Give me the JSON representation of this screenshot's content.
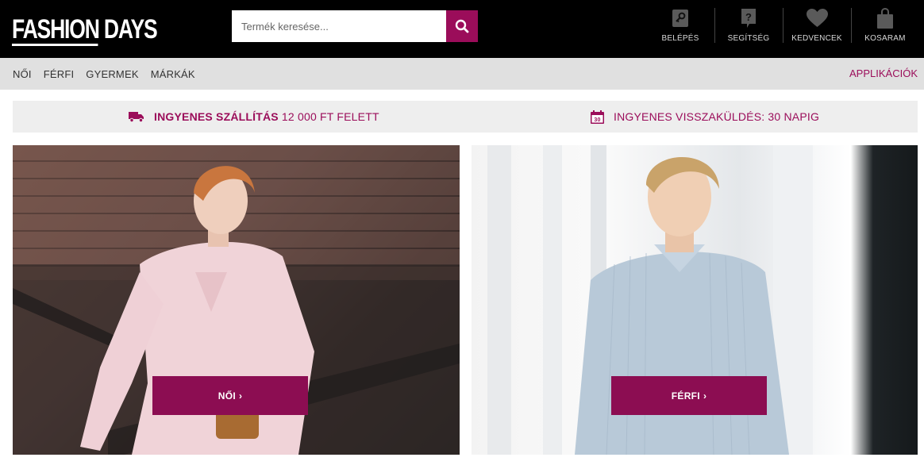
{
  "brand": {
    "logo_word1": "FASHION",
    "logo_word2": "DAYS"
  },
  "search": {
    "placeholder": "Termék keresése...",
    "icon": "search-icon"
  },
  "header_actions": [
    {
      "label": "BELÉPÉS",
      "icon": "key-icon"
    },
    {
      "label": "SEGÍTSÉG",
      "icon": "help-icon"
    },
    {
      "label": "KEDVENCEK",
      "icon": "heart-icon"
    },
    {
      "label": "KOSARAM",
      "icon": "shopping-bag-icon"
    }
  ],
  "nav": {
    "links": [
      "NŐI",
      "FÉRFI",
      "GYERMEK",
      "MÁRKÁK"
    ],
    "apps_label": "APPLIKÁCIÓK"
  },
  "promo": {
    "shipping_bold": "INGYENES SZÁLLÍTÁS",
    "shipping_rest": " 12 000 FT FELETT",
    "shipping_icon": "truck-icon",
    "return_text": "INGYENES VISSZAKÜLDÉS: 30 NAPIG",
    "return_icon": "calendar-icon",
    "calendar_number": "30"
  },
  "tiles": {
    "women_cta": "NŐI",
    "men_cta": "FÉRFI",
    "chevron": "›"
  },
  "colors": {
    "accent": "#9b0d5a",
    "cta": "#8c0d52",
    "header_bg": "#000000",
    "nav_bg": "#e0e0e0",
    "promo_bg": "#eeeeee"
  }
}
